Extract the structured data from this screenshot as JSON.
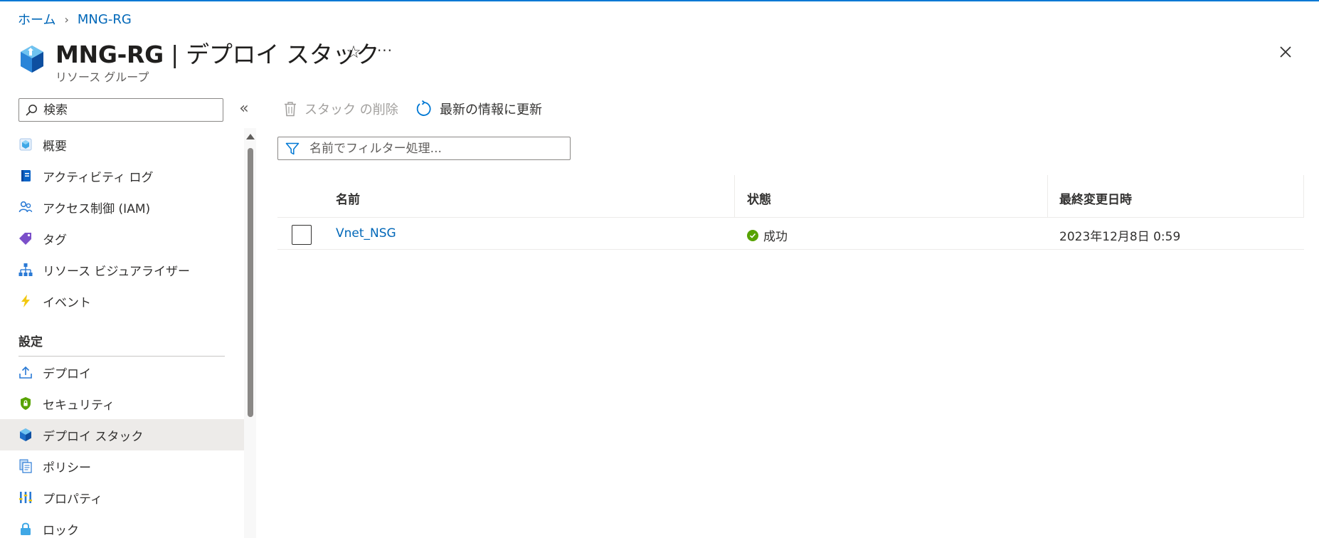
{
  "breadcrumb": {
    "home": "ホーム",
    "current": "MNG-RG"
  },
  "header": {
    "resource_name": "MNG-RG",
    "separator": " | ",
    "page_name": "デプロイ スタック",
    "subtitle": "リソース グループ",
    "star": "☆",
    "more": "···"
  },
  "sidebar": {
    "search_placeholder": "検索",
    "collapse": "«",
    "items": [
      {
        "label": "概要",
        "icon": "overview-cube-icon"
      },
      {
        "label": "アクティビティ ログ",
        "icon": "activity-log-icon"
      },
      {
        "label": "アクセス制御 (IAM)",
        "icon": "access-control-people-icon"
      },
      {
        "label": "タグ",
        "icon": "tag-icon"
      },
      {
        "label": "リソース ビジュアライザー",
        "icon": "resource-visualizer-icon"
      },
      {
        "label": "イベント",
        "icon": "event-bolt-icon"
      }
    ],
    "section_settings": "設定",
    "settings_items": [
      {
        "label": "デプロイ",
        "icon": "deploy-upload-icon"
      },
      {
        "label": "セキュリティ",
        "icon": "security-shield-icon"
      },
      {
        "label": "デプロイ スタック",
        "icon": "deployment-stack-icon",
        "selected": true
      },
      {
        "label": "ポリシー",
        "icon": "policy-document-icon"
      },
      {
        "label": "プロパティ",
        "icon": "properties-bars-icon"
      },
      {
        "label": "ロック",
        "icon": "lock-icon"
      }
    ]
  },
  "toolbar": {
    "delete_label": "スタック の削除",
    "refresh_label": "最新の情報に更新"
  },
  "filter": {
    "placeholder": "名前でフィルター処理..."
  },
  "table": {
    "columns": [
      "名前",
      "状態",
      "最終変更日時"
    ],
    "rows": [
      {
        "name": "Vnet_NSG",
        "status": "成功",
        "modified": "2023年12月8日 0:59"
      }
    ]
  },
  "colors": {
    "accent": "#0078d4",
    "link": "#0067b8",
    "success": "#57a300",
    "selected_bg": "#edebe9"
  }
}
